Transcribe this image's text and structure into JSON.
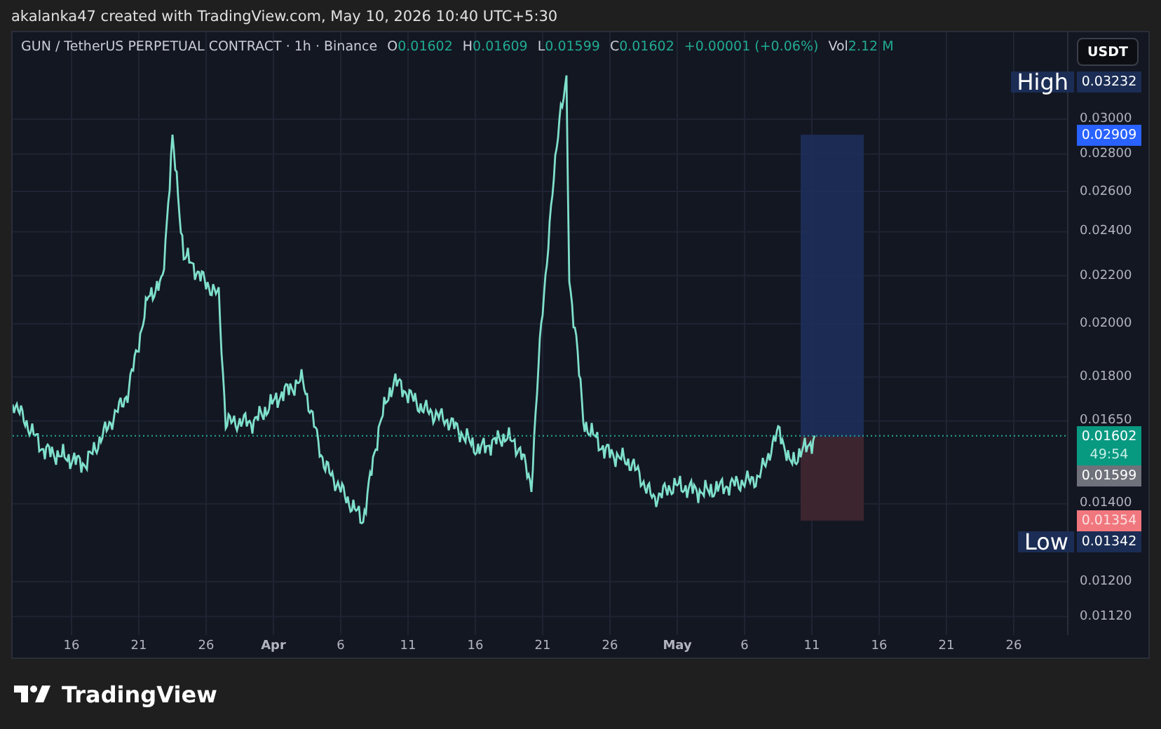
{
  "header": {
    "text": "akalanka47 created with TradingView.com, May 10, 2026 10:40 UTC+5:30"
  },
  "legend": {
    "symbol": "GUN / TetherUS PERPETUAL CONTRACT · 1h · Binance",
    "ohlc": [
      {
        "key": "O",
        "value": "0.01602"
      },
      {
        "key": "H",
        "value": "0.01609"
      },
      {
        "key": "L",
        "value": "0.01599"
      },
      {
        "key": "C",
        "value": "0.01602"
      }
    ],
    "change": "+0.00001 (+0.06%)",
    "volume": {
      "key": "Vol",
      "value": "2.12 M"
    }
  },
  "currency_button": "USDT",
  "price_axis": [
    "0.03000",
    "0.02800",
    "0.02600",
    "0.02400",
    "0.02200",
    "0.02000",
    "0.01800",
    "0.01650",
    "0.01400",
    "0.01200",
    "0.01120"
  ],
  "price_markers": [
    {
      "kind": "high",
      "label": "High",
      "value": "0.03232"
    },
    {
      "kind": "target",
      "value": "0.02909"
    },
    {
      "kind": "last",
      "value": "0.01602",
      "countdown": "49:54"
    },
    {
      "kind": "entry",
      "value": "0.01599"
    },
    {
      "kind": "stop",
      "value": "0.01354"
    },
    {
      "kind": "low",
      "label": "Low",
      "value": "0.01342"
    }
  ],
  "time_axis": [
    {
      "label": "16",
      "major": false
    },
    {
      "label": "21",
      "major": false
    },
    {
      "label": "26",
      "major": false
    },
    {
      "label": "Apr",
      "major": true
    },
    {
      "label": "6",
      "major": false
    },
    {
      "label": "11",
      "major": false
    },
    {
      "label": "16",
      "major": false
    },
    {
      "label": "21",
      "major": false
    },
    {
      "label": "26",
      "major": false
    },
    {
      "label": "May",
      "major": true
    },
    {
      "label": "6",
      "major": false
    },
    {
      "label": "11",
      "major": false
    },
    {
      "label": "16",
      "major": false
    },
    {
      "label": "21",
      "major": false
    },
    {
      "label": "26",
      "major": false
    }
  ],
  "footer": {
    "brand": "TradingView"
  }
}
